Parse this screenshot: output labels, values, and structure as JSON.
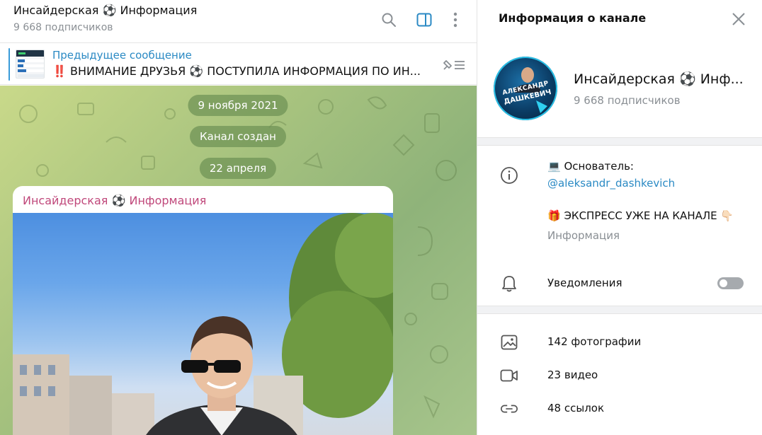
{
  "chat": {
    "title": "Инсайдерская ⚽ Информация",
    "subscribers": "9 668 подписчиков",
    "icons": [
      "search-icon",
      "sidebar-toggle-icon",
      "more-vertical-icon"
    ],
    "pinned": {
      "label": "Предыдущее сообщение",
      "text": "‼️ ВНИМАНИЕ ДРУЗЬЯ ⚽ ПОСТУПИЛА ИНФОРМАЦИЯ ПО ИН..."
    },
    "service": {
      "date1": "9 ноября 2021",
      "created": "Канал создан",
      "date2": "22 апреля"
    },
    "message": {
      "author": "Инсайдерская ⚽ Информация"
    },
    "colors": {
      "accent": "#2b8ac4",
      "author": "#c0487b",
      "bg": "#a9c47f"
    }
  },
  "info": {
    "title": "Информация о канале",
    "avatar": {
      "line1": "АЛЕКСАНДР",
      "line2": "ДАШКЕВИЧ"
    },
    "name": "Инсайдерская ⚽ Инф...",
    "subscribers": "9 668 подписчиков",
    "description": {
      "line1": "💻 Основатель:",
      "link": "@aleksandr_dashkevich",
      "line2": "🎁 ЭКСПРЕСС УЖЕ НА КАНАЛЕ 👇🏻",
      "caption": "Информация"
    },
    "notifications": {
      "label": "Уведомления",
      "enabled": false
    },
    "media": [
      {
        "label": "142 фотографии",
        "icon": "photo-icon"
      },
      {
        "label": "23 видео",
        "icon": "video-icon"
      },
      {
        "label": "48 ссылок",
        "icon": "link-icon"
      }
    ]
  }
}
